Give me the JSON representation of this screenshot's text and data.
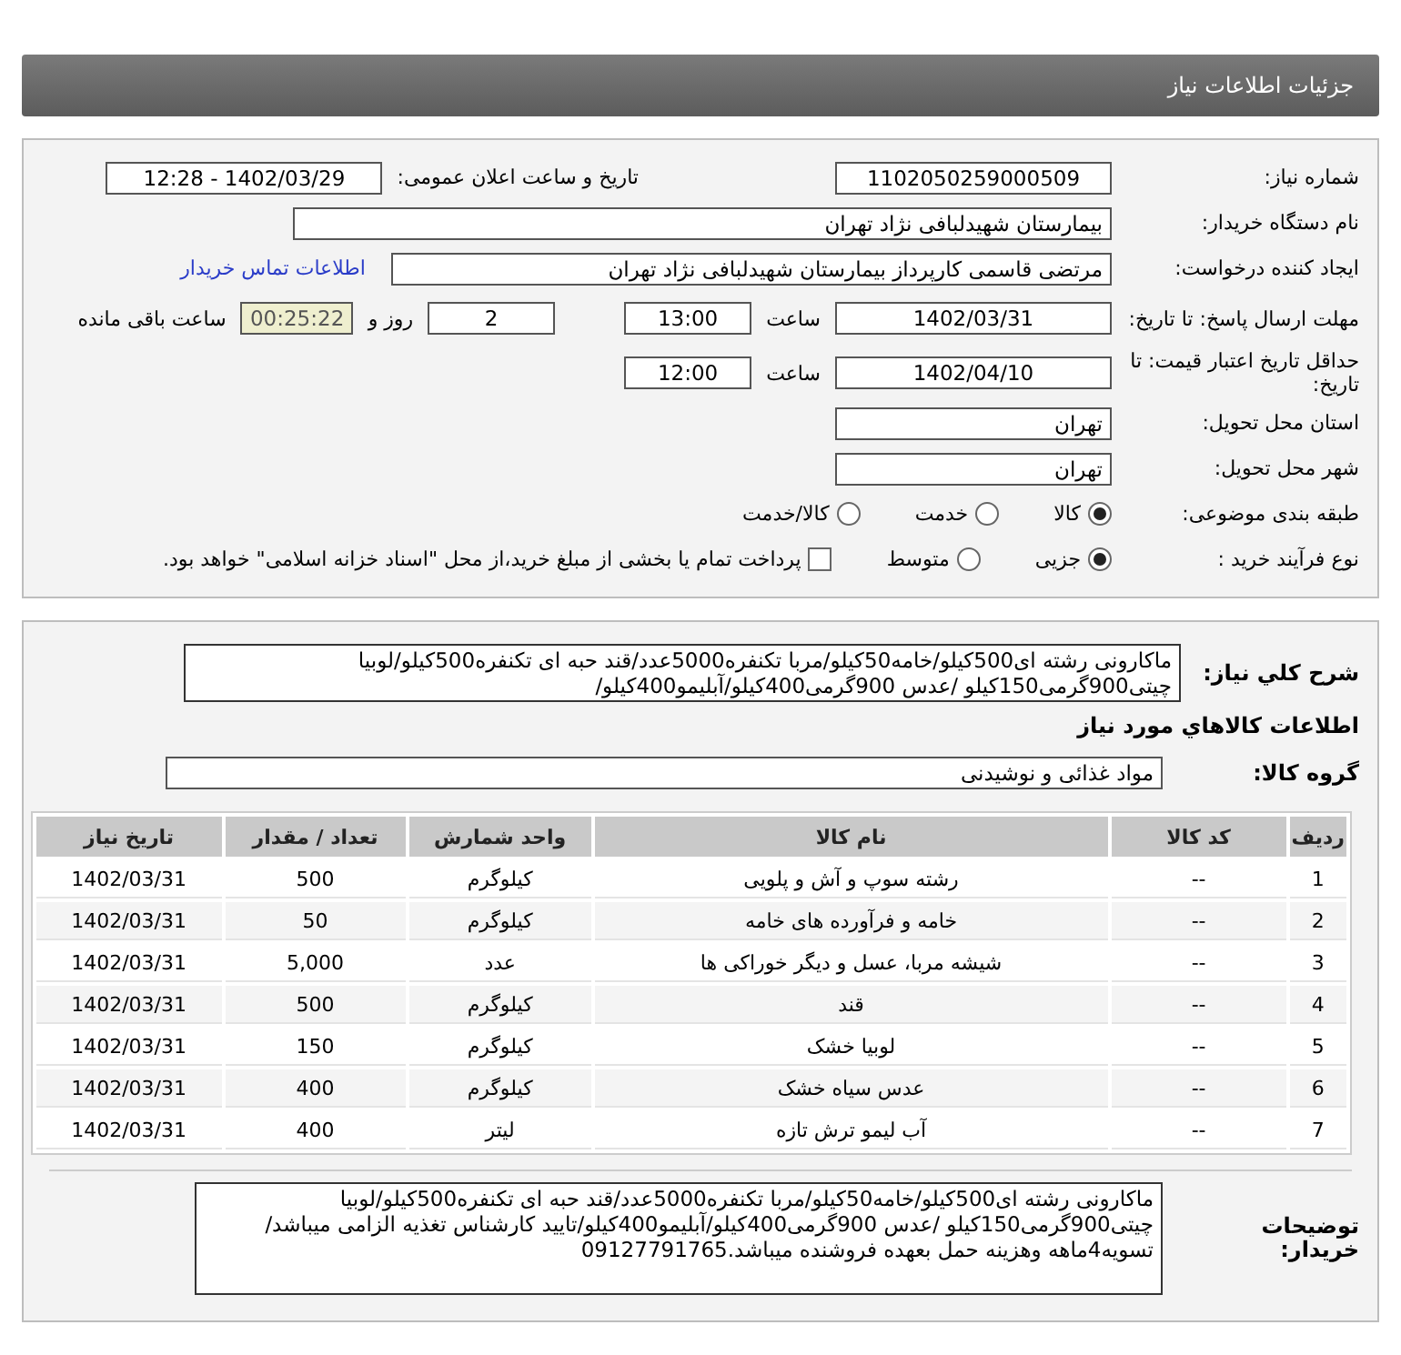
{
  "header": {
    "title": "جزئیات اطلاعات نیاز"
  },
  "info": {
    "need_number": {
      "label": "شماره نیاز:",
      "value": "1102050259000509"
    },
    "announce": {
      "label": "تاریخ و ساعت اعلان عمومی:",
      "value": "1402/03/29 - 12:28"
    },
    "buyer_org": {
      "label": "نام دستگاه خریدار:",
      "value": "بیمارستان شهیدلبافی نژاد تهران"
    },
    "requester": {
      "label": "ایجاد کننده درخواست:",
      "value": "مرتضی  قاسمی کارپرداز بیمارستان شهیدلبافی نژاد تهران",
      "link": "اطلاعات تماس خریدار"
    },
    "deadline": {
      "label": "مهلت ارسال پاسخ: تا تاریخ:",
      "date": "1402/03/31",
      "time_label": "ساعت",
      "time": "13:00",
      "days": "2",
      "days_label": "روز و",
      "remaining": "00:25:22",
      "remaining_label": "ساعت باقی مانده"
    },
    "validity": {
      "label": "حداقل تاریخ اعتبار قیمت: تا تاریخ:",
      "date": "1402/04/10",
      "time_label": "ساعت",
      "time": "12:00"
    },
    "province": {
      "label": "استان محل تحویل:",
      "value": "تهران"
    },
    "city": {
      "label": "شهر محل تحویل:",
      "value": "تهران"
    },
    "category": {
      "label": "طبقه بندی موضوعی:",
      "options": [
        {
          "label": "کالا",
          "selected": true
        },
        {
          "label": "خدمت",
          "selected": false
        },
        {
          "label": "کالا/خدمت",
          "selected": false
        }
      ]
    },
    "process": {
      "label": "نوع فرآیند خرید :",
      "options": [
        {
          "label": "جزیی",
          "selected": true
        },
        {
          "label": "متوسط",
          "selected": false
        }
      ],
      "payment": {
        "label": "پرداخت تمام یا بخشی از مبلغ خرید،از محل \"اسناد خزانه اسلامی\" خواهد بود.",
        "checked": false
      }
    }
  },
  "summary": {
    "label": "شرح کلي نياز:",
    "value": "ماکارونی رشته ای500کیلو/خامه50کیلو/مربا تکنفره5000عدد/قند حبه ای تکنفره500کیلو/لوبیا چیتی900گرمی150کیلو /عدس 900گرمی400کیلو/آبلیمو400کیلو/"
  },
  "goods": {
    "title": "اطلاعات کالاهاي مورد نياز",
    "group": {
      "label": "گروه کالا:",
      "value": "مواد غذائی و نوشیدنی"
    }
  },
  "table": {
    "columns": [
      "ردیف",
      "کد کالا",
      "نام کالا",
      "واحد شمارش",
      "تعداد / مقدار",
      "تاریخ نیاز"
    ],
    "rows": [
      [
        "1",
        "--",
        "رشته سوپ و آش و پلویی",
        "کیلوگرم",
        "500",
        "1402/03/31"
      ],
      [
        "2",
        "--",
        "خامه و فرآورده های خامه",
        "کیلوگرم",
        "50",
        "1402/03/31"
      ],
      [
        "3",
        "--",
        "شیشه مربا، عسل و دیگر خوراکی ها",
        "عدد",
        "5,000",
        "1402/03/31"
      ],
      [
        "4",
        "--",
        "قند",
        "کیلوگرم",
        "500",
        "1402/03/31"
      ],
      [
        "5",
        "--",
        "لوبیا خشک",
        "کیلوگرم",
        "150",
        "1402/03/31"
      ],
      [
        "6",
        "--",
        "عدس سیاه خشک",
        "کیلوگرم",
        "400",
        "1402/03/31"
      ],
      [
        "7",
        "--",
        "آب لیمو ترش تازه",
        "لیتر",
        "400",
        "1402/03/31"
      ]
    ]
  },
  "notes": {
    "label": "توضیحات خریدار:",
    "value": "ماکارونی رشته ای500کیلو/خامه50کیلو/مربا تکنفره5000عدد/قند حبه ای تکنفره500کیلو/لوبیا چیتی900گرمی150کیلو /عدس 900گرمی400کیلو/آبلیمو400کیلو/تایید کارشناس تغذیه الزامی میباشد/تسویه4ماهه وهزینه حمل بعهده فروشنده میباشد.09127791765"
  }
}
